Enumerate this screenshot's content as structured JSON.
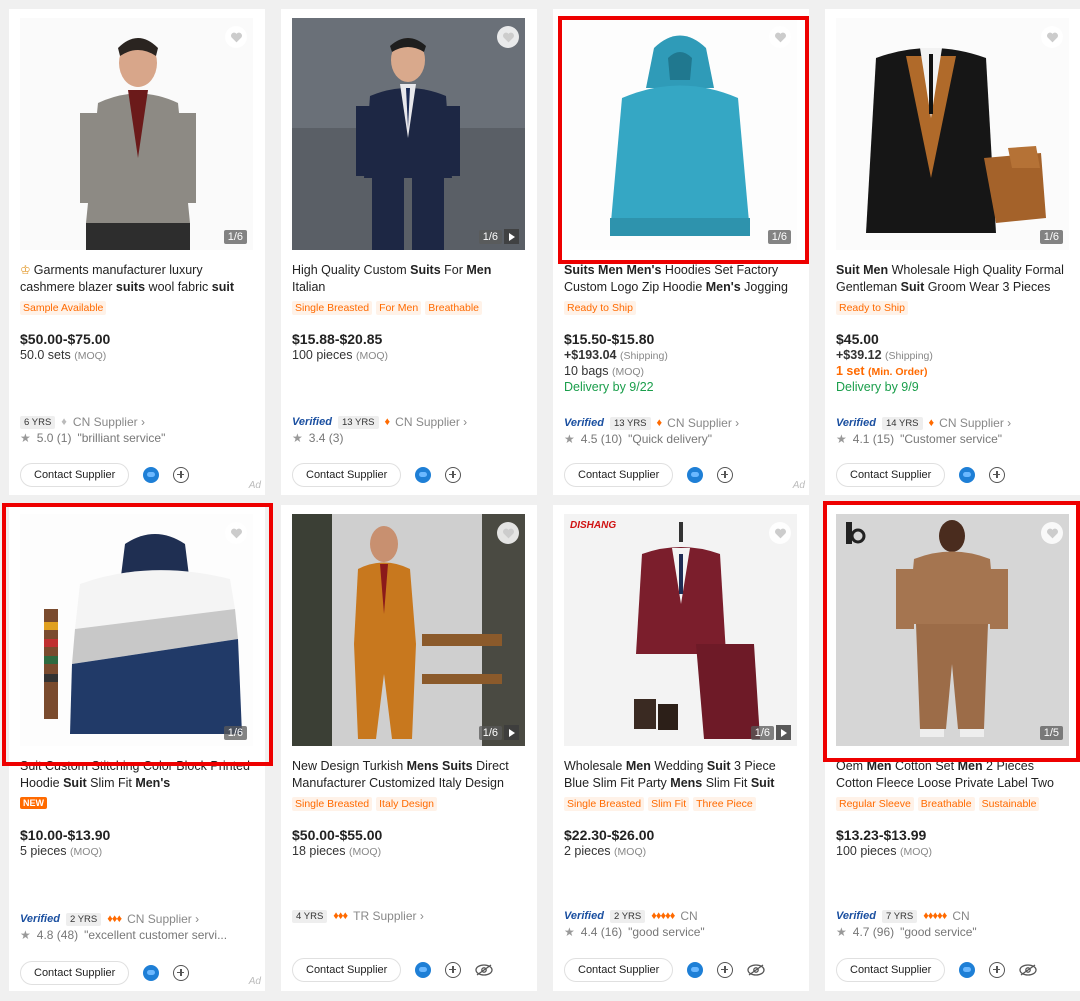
{
  "products": [
    {
      "title_parts": [
        [
          "Garments manufacturer luxury cashmere blazer ",
          false
        ],
        [
          "suits",
          true
        ],
        [
          " wool fabric ",
          false
        ],
        [
          "suit",
          true
        ]
      ],
      "crown": true,
      "tags": [
        "Sample Available"
      ],
      "price": "$50.00-$75.00",
      "moq_qty": "50.0 sets",
      "moq_label": "(MOQ)",
      "img_count": "1/6",
      "years": "6 YRS",
      "supplier_country": "CN Supplier ›",
      "rating": "5.0 (1)",
      "review": "\"brilliant service\"",
      "contact_label": "Contact Supplier",
      "ad": "Ad"
    },
    {
      "title_parts": [
        [
          "High Quality Custom ",
          false
        ],
        [
          "Suits",
          true
        ],
        [
          " For ",
          false
        ],
        [
          "Men",
          true
        ],
        [
          " Italian",
          false
        ]
      ],
      "tags": [
        "Single Breasted",
        "For Men",
        "Breathable"
      ],
      "price": "$15.88-$20.85",
      "moq_qty": "100 pieces",
      "moq_label": "(MOQ)",
      "img_count": "1/6",
      "verified": "Verified",
      "years": "13 YRS",
      "supplier_country": "CN Supplier ›",
      "rating": "3.4 (3)",
      "review": "",
      "contact_label": "Contact Supplier"
    },
    {
      "title_parts": [
        [
          "Suits Men Men's",
          true
        ],
        [
          " Hoodies Set Factory Custom Logo Zip Hoodie ",
          false
        ],
        [
          "Men's",
          true
        ],
        [
          " Jogging",
          false
        ]
      ],
      "tags": [
        "Ready to Ship"
      ],
      "price": "$15.50-$15.80",
      "shipping": "+$193.04",
      "shipping_label": "(Shipping)",
      "moq_qty": "10 bags",
      "moq_label": "(MOQ)",
      "delivery": "Delivery by 9/22",
      "img_count": "1/6",
      "verified": "Verified",
      "years": "13 YRS",
      "supplier_country": "CN Supplier ›",
      "rating": "4.5 (10)",
      "review": "\"Quick delivery\"",
      "contact_label": "Contact Supplier",
      "ad": "Ad"
    },
    {
      "title_parts": [
        [
          "Suit Men",
          true
        ],
        [
          " Wholesale High Quality Formal Gentleman ",
          false
        ],
        [
          "Suit",
          true
        ],
        [
          " Groom Wear 3 Pieces",
          false
        ]
      ],
      "tags": [
        "Ready to Ship"
      ],
      "price": "$45.00",
      "shipping": "+$39.12",
      "shipping_label": "(Shipping)",
      "min_order": "1 set",
      "min_order_label": "(Min. Order)",
      "delivery": "Delivery by 9/9",
      "img_count": "1/6",
      "verified": "Verified",
      "years": "14 YRS",
      "supplier_country": "CN Supplier ›",
      "rating": "4.1 (15)",
      "review": "\"Customer service\"",
      "contact_label": "Contact Supplier"
    },
    {
      "title_parts": [
        [
          "Suit Custom Stitching Color Block Printed Hoodie ",
          false
        ],
        [
          "Suit",
          true
        ],
        [
          " Slim Fit ",
          false
        ],
        [
          "Men's",
          true
        ]
      ],
      "new_badge": "NEW",
      "price": "$10.00-$13.90",
      "moq_qty": "5 pieces",
      "moq_label": "(MOQ)",
      "img_count": "1/6",
      "verified": "Verified",
      "years": "2 YRS",
      "supplier_country": "CN Supplier ›",
      "rating": "4.8 (48)",
      "review": "\"excellent customer servi...",
      "contact_label": "Contact Supplier",
      "ad": "Ad"
    },
    {
      "title_parts": [
        [
          "New Design Turkish ",
          false
        ],
        [
          "Mens Suits",
          true
        ],
        [
          " Direct Manufacturer Customized Italy Design",
          false
        ]
      ],
      "tags": [
        "Single Breasted",
        "Italy Design"
      ],
      "price": "$50.00-$55.00",
      "moq_qty": "18 pieces",
      "moq_label": "(MOQ)",
      "img_count": "1/6",
      "years": "4 YRS",
      "supplier_country": "TR Supplier ›",
      "contact_label": "Contact Supplier"
    },
    {
      "title_parts": [
        [
          "Wholesale ",
          false
        ],
        [
          "Men",
          true
        ],
        [
          " Wedding ",
          false
        ],
        [
          "Suit",
          true
        ],
        [
          " 3 Piece Blue Slim Fit Party ",
          false
        ],
        [
          "Mens",
          true
        ],
        [
          " Slim Fit ",
          false
        ],
        [
          "Suit",
          true
        ]
      ],
      "tags": [
        "Single Breasted",
        "Slim Fit",
        "Three Piece"
      ],
      "price": "$22.30-$26.00",
      "moq_qty": "2 pieces",
      "moq_label": "(MOQ)",
      "img_count": "1/6",
      "brand": "DISHANG",
      "verified": "Verified",
      "years": "2 YRS",
      "supplier_country": "CN",
      "rating": "4.4 (16)",
      "review": "\"good service\"",
      "contact_label": "Contact Supplier"
    },
    {
      "title_parts": [
        [
          "Oem ",
          false
        ],
        [
          "Men",
          true
        ],
        [
          " Cotton Set ",
          false
        ],
        [
          "Men",
          true
        ],
        [
          " 2 Pieces Cotton Fleece Loose Private Label Two",
          false
        ]
      ],
      "tags": [
        "Regular Sleeve",
        "Breathable",
        "Sustainable"
      ],
      "price": "$13.23-$13.99",
      "moq_qty": "100 pieces",
      "moq_label": "(MOQ)",
      "img_count": "1/5",
      "verified": "Verified",
      "years": "7 YRS",
      "supplier_country": "CN",
      "rating": "4.7 (96)",
      "review": "\"good service\"",
      "contact_label": "Contact Supplier"
    }
  ],
  "colors": {
    "accent": "#ff6a00",
    "highlight": "#e00000",
    "verified": "#1a4fa0",
    "delivery": "#1a9e4b"
  }
}
